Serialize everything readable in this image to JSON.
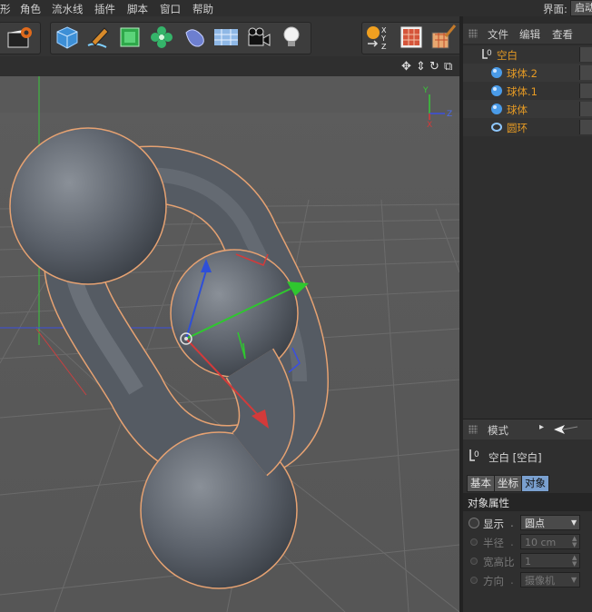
{
  "menubar": {
    "items": [
      "形",
      "角色",
      "流水线",
      "插件",
      "脚本",
      "窗口",
      "帮助"
    ],
    "layout_label": "界面:",
    "layout_value": "启动"
  },
  "toolbar": {
    "icons": [
      "clapperboard-gear-icon",
      "cube-icon",
      "pen-icon",
      "subdivision-cube-icon",
      "array-flower-icon",
      "deformer-icon",
      "floor-icon",
      "camera-icon",
      "light-bulb-icon",
      "xyz-axis-icon",
      "checker-material-icon",
      "render-brush-icon"
    ]
  },
  "viewport": {
    "nav_icons": [
      "move-icon",
      "dolly-icon",
      "rotate-icon",
      "maximize-icon"
    ],
    "axis_labels": {
      "x": "X",
      "y": "Y",
      "z": "Z"
    },
    "colors": {
      "background": "#5a5a5a",
      "grid": "#6a6a6a",
      "object": "#565c66",
      "outline": "#e6a272"
    }
  },
  "object_manager": {
    "tabs": [
      "文件",
      "编辑",
      "查看"
    ],
    "objects": [
      {
        "name": "空白",
        "icon": "null-object-icon",
        "indent": 0
      },
      {
        "name": "球体.2",
        "icon": "sphere-icon",
        "indent": 1
      },
      {
        "name": "球体.1",
        "icon": "sphere-icon",
        "indent": 1
      },
      {
        "name": "球体",
        "icon": "sphere-icon",
        "indent": 1
      },
      {
        "name": "圆环",
        "icon": "circle-spline-icon",
        "indent": 1
      }
    ]
  },
  "attributes": {
    "mode_label": "模式",
    "object_title": "空白 [空白]",
    "tabs": [
      "基本",
      "坐标",
      "对象"
    ],
    "active_tab": "对象",
    "section_title": "对象属性",
    "props": [
      {
        "label": "显示",
        "value": "圆点",
        "type": "dropdown",
        "enabled": true
      },
      {
        "label": "半径",
        "value": "10 cm",
        "type": "spinner",
        "enabled": false
      },
      {
        "label": "宽高比",
        "value": "1",
        "type": "spinner",
        "enabled": false
      },
      {
        "label": "方向",
        "value": "摄像机",
        "type": "dropdown",
        "enabled": false
      }
    ]
  }
}
